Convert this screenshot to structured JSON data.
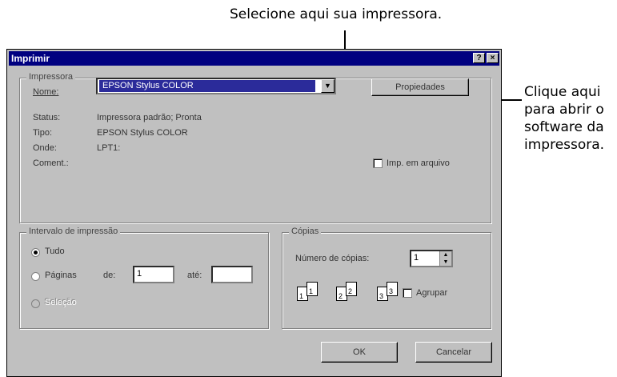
{
  "callouts": {
    "top": "Selecione aqui sua impressora.",
    "right_lines": [
      "Clique aqui",
      "para abrir o",
      "software da",
      "impressora."
    ]
  },
  "dialog": {
    "title": "Imprimir",
    "help_button": "?",
    "close_button": "×",
    "printer_group": {
      "legend": "Impressora",
      "name_label": "Nome:",
      "name_value": "EPSON Stylus COLOR",
      "properties_button": "Propiedades",
      "status_label": "Status:",
      "status_value": "Impressora padrão; Pronta",
      "type_label": "Tipo:",
      "type_value": "EPSON Stylus COLOR",
      "where_label": "Onde:",
      "where_value": "LPT1:",
      "comment_label": "Coment.:",
      "print_to_file_label": "Imp. em arquivo",
      "print_to_file_checked": false
    },
    "range_group": {
      "legend": "Intervalo de impressão",
      "all_label": "Tudo",
      "pages_label": "Páginas",
      "from_label": "de:",
      "from_value": "1",
      "to_label": "até:",
      "to_value": "",
      "selection_label": "Seleção",
      "selected": "all"
    },
    "copies_group": {
      "legend": "Cópias",
      "number_label": "Número de cópias:",
      "number_value": "1",
      "collate_label": "Agrupar",
      "collate_checked": false,
      "collate_icons": [
        "1",
        "1",
        "2",
        "2",
        "3",
        "3"
      ]
    },
    "ok_button": "OK",
    "cancel_button": "Cancelar"
  }
}
